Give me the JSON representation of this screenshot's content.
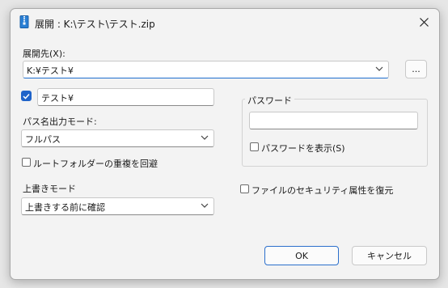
{
  "window": {
    "title": "展開 : K:\\テスト\\テスト.zip",
    "app_icon": "zip-archive-icon",
    "close_icon": "close-icon"
  },
  "destination": {
    "label": "展開先(X):",
    "value": "K:¥テスト¥",
    "browse_label": "..."
  },
  "subfolder": {
    "checked": true,
    "value": "テスト¥"
  },
  "path_mode": {
    "label": "パス名出力モード:",
    "selected": "フルパス"
  },
  "avoid_duplicate": {
    "label": "ルートフォルダーの重複を回避",
    "checked": false
  },
  "overwrite": {
    "label": "上書きモード",
    "selected": "上書きする前に確認"
  },
  "password": {
    "group_label": "パスワード",
    "value": "",
    "show_label": "パスワードを表示(S)",
    "show_checked": false
  },
  "restore_security": {
    "label": "ファイルのセキュリティ属性を復元",
    "checked": false
  },
  "buttons": {
    "ok": "OK",
    "cancel": "キャンセル"
  },
  "colors": {
    "accent": "#1f63c9",
    "dialog_bg": "#f3f3f3"
  }
}
